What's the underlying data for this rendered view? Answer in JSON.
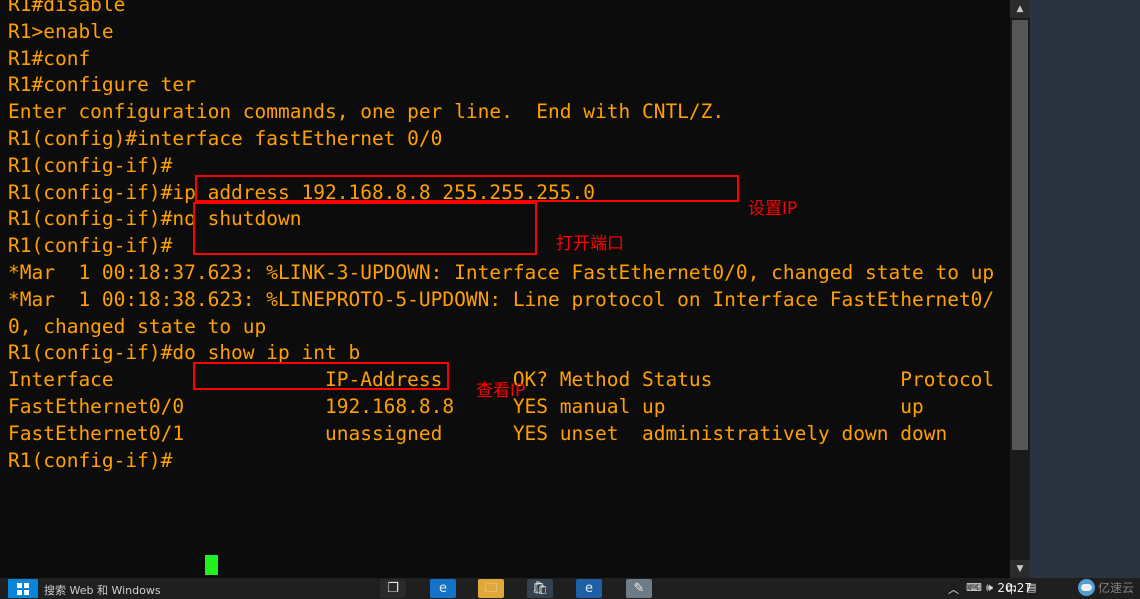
{
  "terminal": {
    "name": "cisco-router-cli",
    "text": "R1#disable\nR1>enable\nR1#conf\nR1#configure ter\nEnter configuration commands, one per line.  End with CNTL/Z.\nR1(config)#interface fastEthernet 0/0\nR1(config-if)#\nR1(config-if)#ip address 192.168.8.8 255.255.255.0\nR1(config-if)#no shutdown\nR1(config-if)#\n*Mar  1 00:18:37.623: %LINK-3-UPDOWN: Interface FastEthernet0/0, changed state to up\n*Mar  1 00:18:38.623: %LINEPROTO-5-UPDOWN: Line protocol on Interface FastEthernet0/0, changed state to up\nR1(config-if)#do show ip int b\nInterface                  IP-Address      OK? Method Status                Protocol\nFastEthernet0/0            192.168.8.8     YES manual up                    up\nFastEthernet0/1            unassigned      YES unset  administratively down down\nR1(config-if)#",
    "foreground_color": "#ffa000",
    "background_color": "#0c0c0c",
    "cursor_color": "#21f021"
  },
  "annotations": {
    "accent_color": "#ff0000",
    "items": [
      {
        "label": "设置IP",
        "target": "ip address 192.168.8.8 255.255.255.0"
      },
      {
        "label": "打开端口",
        "target": "no shutdown"
      },
      {
        "label": "查看IP",
        "target": "do show ip int b"
      }
    ]
  },
  "scrollbar": {
    "up_arrow": "▲",
    "down_arrow": "▼"
  },
  "taskbar": {
    "search_placeholder": "搜索 Web 和 Windows",
    "clock": "20:27",
    "icons": [
      {
        "name": "task-view-icon",
        "glyph": "❐"
      },
      {
        "name": "edge-browser-icon",
        "glyph": "e"
      },
      {
        "name": "file-explorer-icon",
        "glyph": "🗀"
      },
      {
        "name": "store-icon",
        "glyph": "🛍"
      },
      {
        "name": "browser-icon",
        "glyph": "e"
      },
      {
        "name": "packet-tracer-icon",
        "glyph": "✎"
      }
    ],
    "tray": [
      {
        "name": "show-hidden-icons",
        "glyph": "︿"
      },
      {
        "name": "network-icon",
        "glyph": "⌨"
      },
      {
        "name": "volume-icon",
        "glyph": "🕪"
      },
      {
        "name": "ime-icon",
        "glyph": "中"
      },
      {
        "name": "action-center-icon",
        "glyph": "▤"
      }
    ]
  },
  "watermark": {
    "text": "亿速云"
  }
}
